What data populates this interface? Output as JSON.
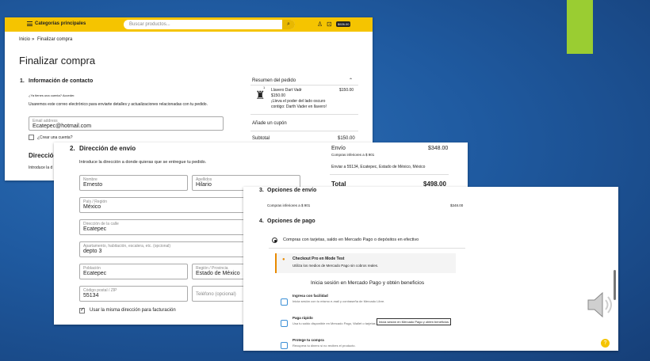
{
  "s1": {
    "categories": "Categorías principales",
    "search_placeholder": "Buscar productos...",
    "cart_total": "$926.00",
    "breadcrumb_home": "Inicio",
    "breadcrumb_sep": "»",
    "breadcrumb_current": "Finalizar compra",
    "page_title": "Finalizar compra",
    "step1_num": "1.",
    "step1_title": "Información de contacto",
    "have_account": "¿Ya tienes una cuenta? Acceder.",
    "email_note": "Usaremos este correo electrónico para enviarte detalles y actualizaciones relacionadas con tu pedido.",
    "email_label": "Email address",
    "email_value": "Ecatepec@hotmail.com",
    "create_account": "¿Crear una cuenta?",
    "step2_partial": "Direcció",
    "intro_partial": "Introduce la d",
    "summary_title": "Resumen del pedido",
    "product_name": "Llavero Dart Vadr",
    "product_qty": "1",
    "product_price": "$150.00",
    "product_total": "$150.00",
    "product_desc1": "¡Lleva el poder del lado oscuro",
    "product_desc2": "contigo: Darth Vader en llavero!",
    "coupon": "Añade un cupón",
    "subtotal_label": "Subtotal",
    "subtotal_value": "$150.00"
  },
  "s2": {
    "step_num": "2.",
    "step_title": "Dirección de envío",
    "intro": "Introduce la dirección a donde quieras que se entregue tu pedido.",
    "fields": {
      "nombre_label": "Nombre",
      "nombre_value": "Ernesto",
      "apellidos_label": "Apellidos",
      "apellidos_value": "Hilario",
      "pais_label": "País / Región",
      "pais_value": "México",
      "calle_label": "Dirección de la calle",
      "calle_value": "Ecatepec",
      "apto_label": "Apartamento, habitación, escalera, etc. (opcional)",
      "apto_value": "depto 3",
      "poblacion_label": "Población",
      "poblacion_value": "Ecatepec",
      "region_label": "Región / Provincia",
      "region_value": "Estado de México",
      "cp_label": "Código postal / ZIP",
      "cp_value": "55134",
      "telefono_label": "Teléfono (opcional)"
    },
    "same_address": "Usar la misma dirección para facturación",
    "envio_label": "Envío",
    "envio_value": "$348.00",
    "envio_note": "Compras inferiores a $ 901",
    "envio_dest": "Enviar a 55134, Ecatepec, Estado de México, México",
    "total_label": "Total",
    "total_value": "$498.00"
  },
  "s3": {
    "step3_num": "3.",
    "step3_title": "Opciones de envío",
    "ship_option": "Compras inferiores a $ 901",
    "ship_price": "$348.00",
    "step4_num": "4.",
    "step4_title": "Opciones de pago",
    "pay_option": "Compras con tarjetas, saldo en Mercado Pago o depósitos en efectivo",
    "warn_title": "Checkout Pro en Mode Test",
    "warn_text": "Utiliza los medios de Mercado Pago sin cobros reales.",
    "mp_heading": "Inicia sesión en Mercado Pago y obtén beneficios",
    "b1_title": "Ingresa con facilidad",
    "b1_text": "Inicia sesión con tu mismo e-mail y contraseña de Mercado Libre.",
    "b2_title": "Paga rápido",
    "b2_text": "Usa tu saldo disponible en Mercado Pago, Wallet o tarjetas guardadas.",
    "b3_title": "Protege tu compra",
    "b3_text": "Recupera tu dinero si no recibes el producto.",
    "tooltip": "Inicia sesión en Mercado Pago y obtén beneficios"
  }
}
